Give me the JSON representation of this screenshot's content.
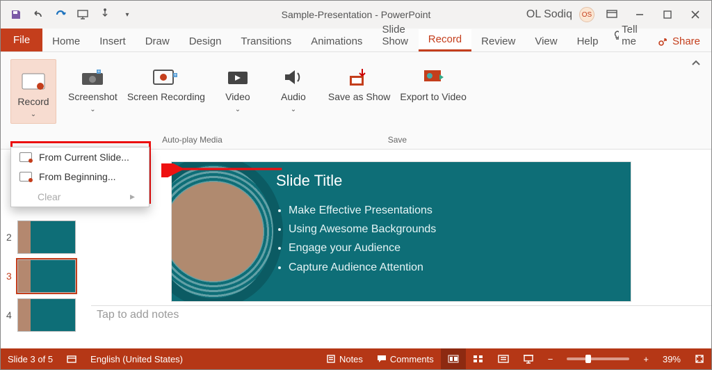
{
  "title": "Sample-Presentation  -  PowerPoint",
  "user": {
    "name": "OL Sodiq",
    "initials": "OS"
  },
  "tabs": {
    "file": "File",
    "items": [
      "Home",
      "Insert",
      "Draw",
      "Design",
      "Transitions",
      "Animations",
      "Slide Show",
      "Record",
      "Review",
      "View",
      "Help"
    ],
    "active_index": 7,
    "tellme": "Tell me",
    "share": "Share"
  },
  "ribbon": {
    "record": {
      "button": "Record",
      "menu": {
        "from_current": "From Current Slide...",
        "from_beginning": "From Beginning...",
        "clear": "Clear"
      }
    },
    "screenshot": "Screenshot",
    "screen_recording": "Screen Recording",
    "video": "Video",
    "audio": "Audio",
    "save_as_show": "Save as Show",
    "export_video": "Export to Video",
    "groups": {
      "autoplay": "Auto-play Media",
      "save": "Save"
    }
  },
  "thumbs": {
    "visible": [
      "2",
      "3",
      "4"
    ],
    "current": "3"
  },
  "slide": {
    "title": "Slide Title",
    "bullets": [
      "Make Effective Presentations",
      "Using Awesome Backgrounds",
      "Engage your Audience",
      "Capture Audience Attention"
    ]
  },
  "notes_placeholder": "Tap to add notes",
  "status": {
    "counter": "Slide 3 of 5",
    "language": "English (United States)",
    "notes": "Notes",
    "comments": "Comments",
    "zoom": "39%"
  }
}
